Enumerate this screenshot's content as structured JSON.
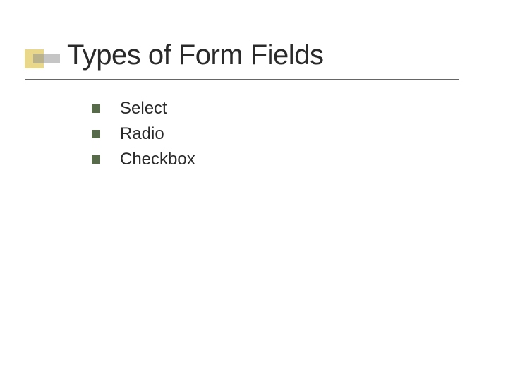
{
  "slide": {
    "title": "Types of Form Fields",
    "bullets": [
      "Select",
      "Radio",
      "Checkbox"
    ]
  },
  "colors": {
    "accent_square": "#e9d88a",
    "bullet_square": "#576a4a",
    "underline": "#666666",
    "text": "#2a2a2a"
  }
}
